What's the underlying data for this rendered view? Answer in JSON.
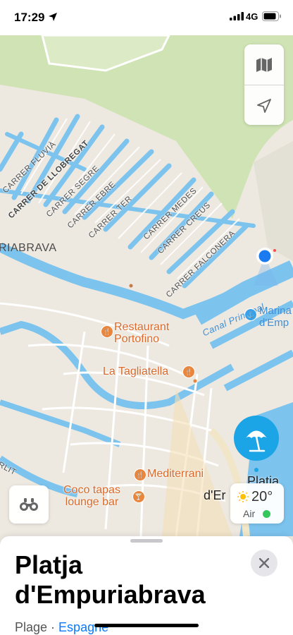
{
  "status_bar": {
    "time": "17:29",
    "network": "4G"
  },
  "map": {
    "district_label": "RIABRAVA",
    "streets": [
      "CARRER FLUVIÀ",
      "CARRER DE LLOBREGAT",
      "CARRER SEGRE",
      "CARRER EBRE",
      "CARRER TER",
      "CARRER MEDES",
      "CARRER CREUS",
      "CARRER FALCONERA"
    ],
    "edge_street": "RLIT",
    "canal_label": "Canal Principal",
    "marina_label": [
      "Marina",
      "d'Emp"
    ],
    "pois": {
      "restaurant_portofino": [
        "Restaurant",
        "Portofino"
      ],
      "la_tagliatella": "La Tagliatella",
      "mediterrani": "Mediterrani",
      "coco_tapas": [
        "Coco tapas",
        "lounge bar"
      ]
    },
    "selected_pin_label": [
      "Platja",
      "d'Er"
    ]
  },
  "weather": {
    "temp": "20°",
    "air_label": "Air"
  },
  "sheet": {
    "title": "Platja d'Empuriabrava",
    "category": "Plage",
    "separator": " · ",
    "country": "Espagne"
  },
  "colors": {
    "water": "#7cc3ee",
    "land": "#ede9e1",
    "park": "#cfe3b4",
    "accent": "#0a7aff",
    "poi": "#d9692a",
    "pin": "#1ba4e6"
  }
}
